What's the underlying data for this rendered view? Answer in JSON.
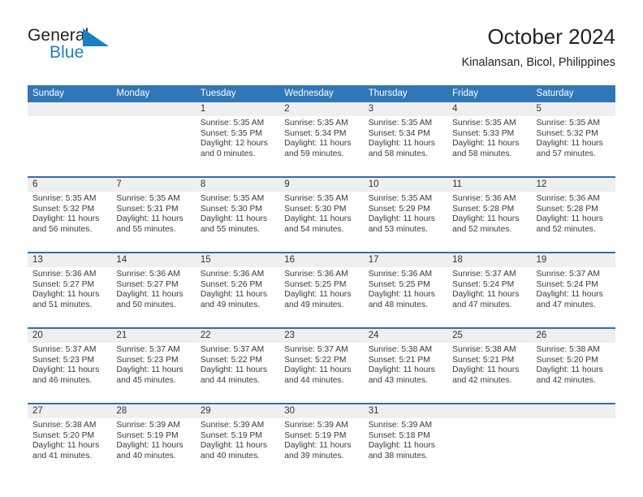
{
  "brand": {
    "name_part1": "General",
    "name_part2": "Blue",
    "flag_icon": "blue-flag-icon",
    "colors": {
      "dark": "#231f20",
      "blue": "#1c7fc4"
    }
  },
  "header": {
    "title": "October 2024",
    "subtitle": "Kinalansan, Bicol, Philippines"
  },
  "colors": {
    "header_blue": "#3077b8",
    "row_rule_blue": "#2f6fb0",
    "day_strip_gray": "#efefef",
    "text": "#3a3a3a"
  },
  "calendar": {
    "weekdays": [
      "Sunday",
      "Monday",
      "Tuesday",
      "Wednesday",
      "Thursday",
      "Friday",
      "Saturday"
    ],
    "weeks": [
      [
        {
          "day": "",
          "lines": []
        },
        {
          "day": "",
          "lines": []
        },
        {
          "day": "1",
          "lines": [
            "Sunrise: 5:35 AM",
            "Sunset: 5:35 PM",
            "Daylight: 12 hours",
            "and 0 minutes."
          ]
        },
        {
          "day": "2",
          "lines": [
            "Sunrise: 5:35 AM",
            "Sunset: 5:34 PM",
            "Daylight: 11 hours",
            "and 59 minutes."
          ]
        },
        {
          "day": "3",
          "lines": [
            "Sunrise: 5:35 AM",
            "Sunset: 5:34 PM",
            "Daylight: 11 hours",
            "and 58 minutes."
          ]
        },
        {
          "day": "4",
          "lines": [
            "Sunrise: 5:35 AM",
            "Sunset: 5:33 PM",
            "Daylight: 11 hours",
            "and 58 minutes."
          ]
        },
        {
          "day": "5",
          "lines": [
            "Sunrise: 5:35 AM",
            "Sunset: 5:32 PM",
            "Daylight: 11 hours",
            "and 57 minutes."
          ]
        }
      ],
      [
        {
          "day": "6",
          "lines": [
            "Sunrise: 5:35 AM",
            "Sunset: 5:32 PM",
            "Daylight: 11 hours",
            "and 56 minutes."
          ]
        },
        {
          "day": "7",
          "lines": [
            "Sunrise: 5:35 AM",
            "Sunset: 5:31 PM",
            "Daylight: 11 hours",
            "and 55 minutes."
          ]
        },
        {
          "day": "8",
          "lines": [
            "Sunrise: 5:35 AM",
            "Sunset: 5:30 PM",
            "Daylight: 11 hours",
            "and 55 minutes."
          ]
        },
        {
          "day": "9",
          "lines": [
            "Sunrise: 5:35 AM",
            "Sunset: 5:30 PM",
            "Daylight: 11 hours",
            "and 54 minutes."
          ]
        },
        {
          "day": "10",
          "lines": [
            "Sunrise: 5:35 AM",
            "Sunset: 5:29 PM",
            "Daylight: 11 hours",
            "and 53 minutes."
          ]
        },
        {
          "day": "11",
          "lines": [
            "Sunrise: 5:36 AM",
            "Sunset: 5:28 PM",
            "Daylight: 11 hours",
            "and 52 minutes."
          ]
        },
        {
          "day": "12",
          "lines": [
            "Sunrise: 5:36 AM",
            "Sunset: 5:28 PM",
            "Daylight: 11 hours",
            "and 52 minutes."
          ]
        }
      ],
      [
        {
          "day": "13",
          "lines": [
            "Sunrise: 5:36 AM",
            "Sunset: 5:27 PM",
            "Daylight: 11 hours",
            "and 51 minutes."
          ]
        },
        {
          "day": "14",
          "lines": [
            "Sunrise: 5:36 AM",
            "Sunset: 5:27 PM",
            "Daylight: 11 hours",
            "and 50 minutes."
          ]
        },
        {
          "day": "15",
          "lines": [
            "Sunrise: 5:36 AM",
            "Sunset: 5:26 PM",
            "Daylight: 11 hours",
            "and 49 minutes."
          ]
        },
        {
          "day": "16",
          "lines": [
            "Sunrise: 5:36 AM",
            "Sunset: 5:25 PM",
            "Daylight: 11 hours",
            "and 49 minutes."
          ]
        },
        {
          "day": "17",
          "lines": [
            "Sunrise: 5:36 AM",
            "Sunset: 5:25 PM",
            "Daylight: 11 hours",
            "and 48 minutes."
          ]
        },
        {
          "day": "18",
          "lines": [
            "Sunrise: 5:37 AM",
            "Sunset: 5:24 PM",
            "Daylight: 11 hours",
            "and 47 minutes."
          ]
        },
        {
          "day": "19",
          "lines": [
            "Sunrise: 5:37 AM",
            "Sunset: 5:24 PM",
            "Daylight: 11 hours",
            "and 47 minutes."
          ]
        }
      ],
      [
        {
          "day": "20",
          "lines": [
            "Sunrise: 5:37 AM",
            "Sunset: 5:23 PM",
            "Daylight: 11 hours",
            "and 46 minutes."
          ]
        },
        {
          "day": "21",
          "lines": [
            "Sunrise: 5:37 AM",
            "Sunset: 5:23 PM",
            "Daylight: 11 hours",
            "and 45 minutes."
          ]
        },
        {
          "day": "22",
          "lines": [
            "Sunrise: 5:37 AM",
            "Sunset: 5:22 PM",
            "Daylight: 11 hours",
            "and 44 minutes."
          ]
        },
        {
          "day": "23",
          "lines": [
            "Sunrise: 5:37 AM",
            "Sunset: 5:22 PM",
            "Daylight: 11 hours",
            "and 44 minutes."
          ]
        },
        {
          "day": "24",
          "lines": [
            "Sunrise: 5:38 AM",
            "Sunset: 5:21 PM",
            "Daylight: 11 hours",
            "and 43 minutes."
          ]
        },
        {
          "day": "25",
          "lines": [
            "Sunrise: 5:38 AM",
            "Sunset: 5:21 PM",
            "Daylight: 11 hours",
            "and 42 minutes."
          ]
        },
        {
          "day": "26",
          "lines": [
            "Sunrise: 5:38 AM",
            "Sunset: 5:20 PM",
            "Daylight: 11 hours",
            "and 42 minutes."
          ]
        }
      ],
      [
        {
          "day": "27",
          "lines": [
            "Sunrise: 5:38 AM",
            "Sunset: 5:20 PM",
            "Daylight: 11 hours",
            "and 41 minutes."
          ]
        },
        {
          "day": "28",
          "lines": [
            "Sunrise: 5:39 AM",
            "Sunset: 5:19 PM",
            "Daylight: 11 hours",
            "and 40 minutes."
          ]
        },
        {
          "day": "29",
          "lines": [
            "Sunrise: 5:39 AM",
            "Sunset: 5:19 PM",
            "Daylight: 11 hours",
            "and 40 minutes."
          ]
        },
        {
          "day": "30",
          "lines": [
            "Sunrise: 5:39 AM",
            "Sunset: 5:19 PM",
            "Daylight: 11 hours",
            "and 39 minutes."
          ]
        },
        {
          "day": "31",
          "lines": [
            "Sunrise: 5:39 AM",
            "Sunset: 5:18 PM",
            "Daylight: 11 hours",
            "and 38 minutes."
          ]
        },
        {
          "day": "",
          "lines": []
        },
        {
          "day": "",
          "lines": []
        }
      ]
    ]
  }
}
